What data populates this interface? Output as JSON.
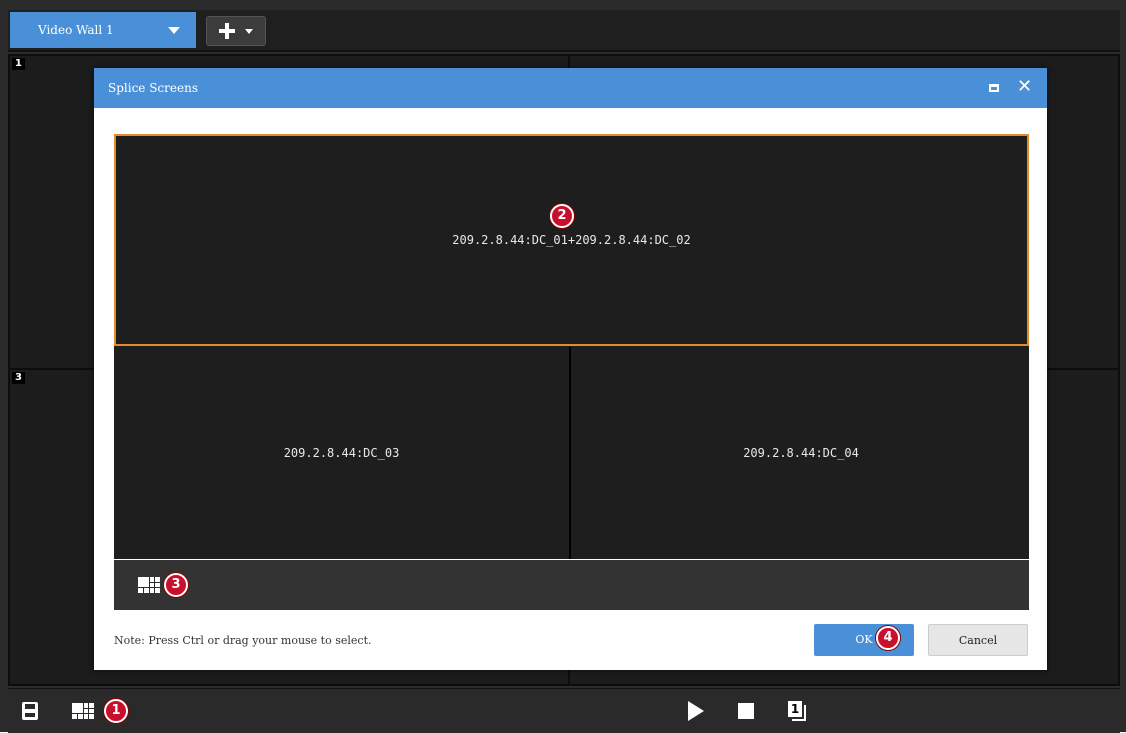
{
  "topbar": {
    "tab_label": "Video Wall 1"
  },
  "wall": {
    "cell_numbers": [
      "1",
      "3"
    ]
  },
  "dialog": {
    "title": "Splice Screens",
    "screens": [
      "209.2.8.44:DC_01+209.2.8.44:DC_02",
      "209.2.8.44:DC_03",
      "209.2.8.44:DC_04"
    ],
    "note": "Note: Press Ctrl or drag your mouse to select.",
    "ok_label": "OK",
    "cancel_label": "Cancel"
  },
  "callouts": [
    "1",
    "2",
    "3",
    "4"
  ],
  "colors": {
    "accent": "#4a90d9",
    "selection": "#e38a2a",
    "callout": "#c8102e"
  }
}
